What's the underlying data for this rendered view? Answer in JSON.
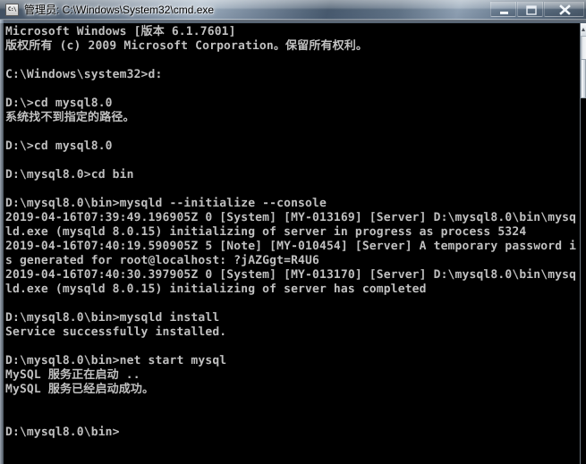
{
  "window": {
    "title": "管理员: C:\\Windows\\System32\\cmd.exe",
    "icon_name": "cmd-icon",
    "icon_glyph": "C:\\",
    "controls": {
      "minimize_label": "最小化",
      "maximize_label": "最大化",
      "close_label": "关闭"
    }
  },
  "console": {
    "background_color": "#000000",
    "text_color": "#c0c0c0",
    "lines": [
      "Microsoft Windows [版本 6.1.7601]",
      "版权所有 (c) 2009 Microsoft Corporation。保留所有权利。",
      "",
      "C:\\Windows\\system32>d:",
      "",
      "D:\\>cd mysql8.0",
      "系统找不到指定的路径。",
      "",
      "D:\\>cd mysql8.0",
      "",
      "D:\\mysql8.0>cd bin",
      "",
      "D:\\mysql8.0\\bin>mysqld --initialize --console",
      "2019-04-16T07:39:49.196905Z 0 [System] [MY-013169] [Server] D:\\mysql8.0\\bin\\mysq",
      "ld.exe (mysqld 8.0.15) initializing of server in progress as process 5324",
      "2019-04-16T07:40:19.590905Z 5 [Note] [MY-010454] [Server] A temporary password i",
      "s generated for root@localhost: ?jAZGgt=R4U6",
      "2019-04-16T07:40:30.397905Z 0 [System] [MY-013170] [Server] D:\\mysql8.0\\bin\\mysq",
      "ld.exe (mysqld 8.0.15) initializing of server has completed",
      "",
      "D:\\mysql8.0\\bin>mysqld install",
      "Service successfully installed.",
      "",
      "D:\\mysql8.0\\bin>net start mysql",
      "MySQL 服务正在启动 ..",
      "MySQL 服务已经启动成功。",
      "",
      "",
      "D:\\mysql8.0\\bin>"
    ]
  },
  "scrollbar": {
    "up_arrow_name": "scroll-up-arrow",
    "thumb_name": "scroll-thumb"
  }
}
